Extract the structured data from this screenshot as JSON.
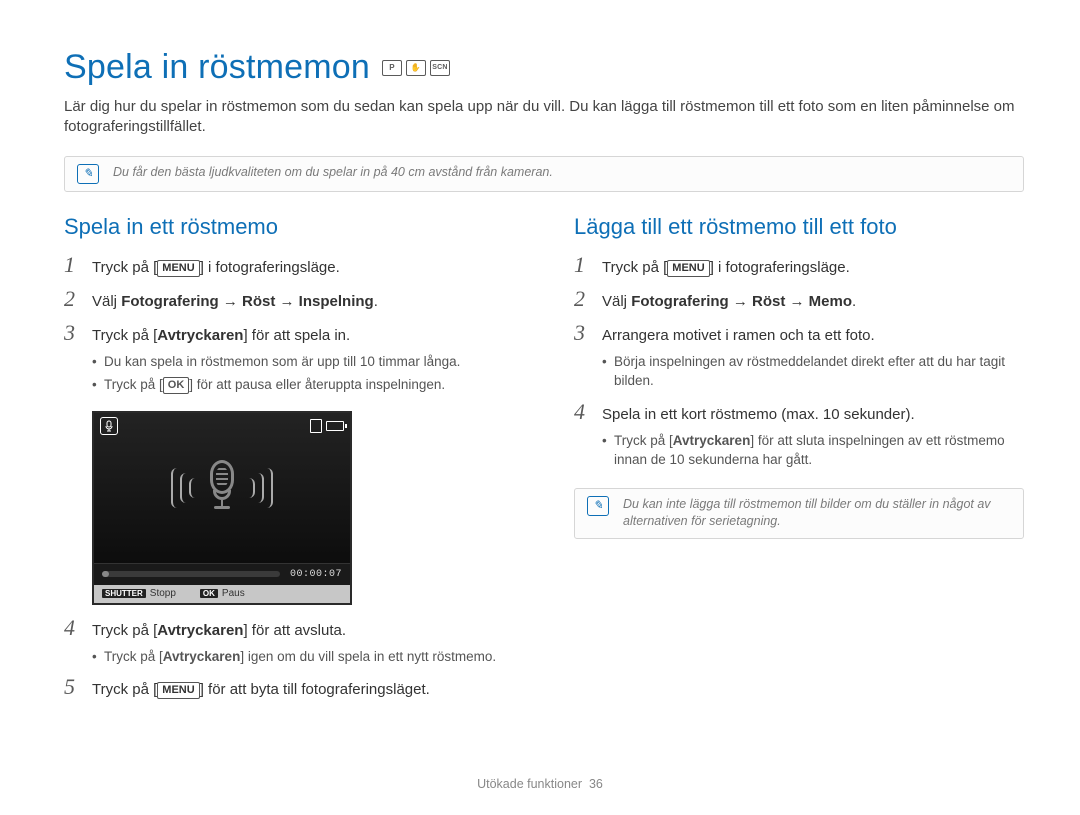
{
  "title": "Spela in röstmemon",
  "intro": "Lär dig hur du spelar in röstmemon som du sedan kan spela upp när du vill. Du kan lägga till röstmemon till ett foto som en liten påminnelse om fotograferingstillfället.",
  "top_note": "Du får den bästa ljudkvaliteten om du spelar in på 40 cm avstånd från kameran.",
  "left": {
    "heading": "Spela in ett röstmemo",
    "step1_pre": "Tryck på [",
    "step1_menu": "MENU",
    "step1_post": "] i fotograferingsläge.",
    "step2_pre": "Välj ",
    "step2_bold": "Fotografering → Röst → Inspelning",
    "step2_post": ".",
    "step3_pre": "Tryck på [",
    "step3_bold": "Avtryckaren",
    "step3_post": "] för att spela in.",
    "step3_bullets": [
      "Du kan spela in röstmemon som är upp till 10 timmar långa.",
      "Tryck på [OK] för att pausa eller återuppta inspelningen."
    ],
    "lcd": {
      "time": "00:00:07",
      "shutter_label": "SHUTTER",
      "shutter_text": "Stopp",
      "ok_label": "OK",
      "ok_text": "Paus"
    },
    "step4_pre": "Tryck på [",
    "step4_bold": "Avtryckaren",
    "step4_post": "] för att avsluta.",
    "step4_bullets": [
      "Tryck på [Avtryckaren] igen om du vill spela in ett nytt röstmemo."
    ],
    "step5_pre": "Tryck på [",
    "step5_menu": "MENU",
    "step5_post": "] för att byta till fotograferingsläget."
  },
  "right": {
    "heading": "Lägga till ett röstmemo till ett foto",
    "step1_pre": "Tryck på [",
    "step1_menu": "MENU",
    "step1_post": "] i fotograferingsläge.",
    "step2_pre": "Välj ",
    "step2_bold": "Fotografering → Röst → Memo",
    "step2_post": ".",
    "step3": "Arrangera motivet i ramen och ta ett foto.",
    "step3_bullets": [
      "Börja inspelningen av röstmeddelandet direkt efter att du har tagit bilden."
    ],
    "step4": "Spela in ett kort röstmemo (max. 10 sekunder).",
    "step4_bullets": [
      "Tryck på [Avtryckaren] för att sluta inspelningen av ett röstmemo innan de 10 sekunderna har gått."
    ],
    "note": "Du kan inte lägga till röstmemon till bilder om du ställer in något av alternativen för serietagning."
  },
  "footer_label": "Utökade funktioner",
  "footer_page": "36"
}
